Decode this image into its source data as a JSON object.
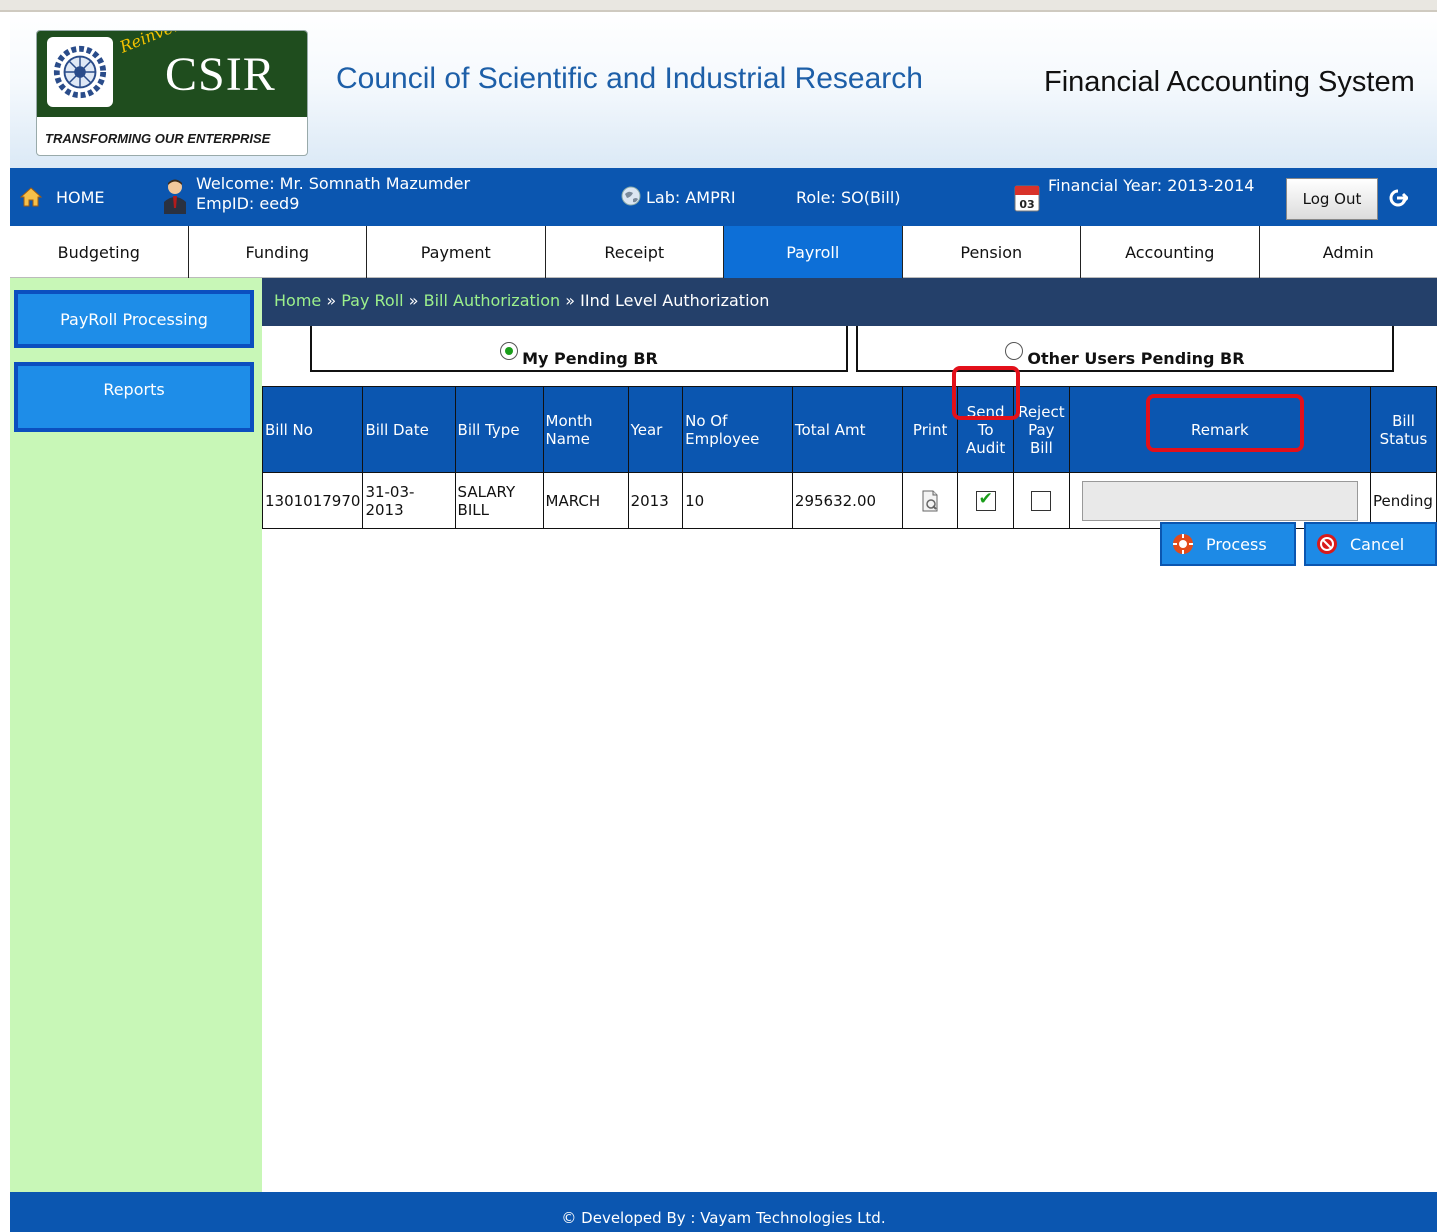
{
  "header": {
    "logo_text": "CSIR",
    "logo_script": "Reinventing",
    "logo_tagline": "TRANSFORMING OUR ENTERPRISE",
    "org_title": "Council of Scientific and Industrial Research",
    "system_title": "Financial Accounting System"
  },
  "userbar": {
    "home": "HOME",
    "welcome_line1": "Welcome: Mr. Somnath Mazumder",
    "welcome_line2": "EmpID: eed9",
    "lab": "Lab: AMPRI",
    "role": "Role: SO(Bill)",
    "financial_year": "Financial Year: 2013-2014",
    "logout": "Log Out",
    "calendar_day": "03"
  },
  "nav": {
    "tabs": [
      "Budgeting",
      "Funding",
      "Payment",
      "Receipt",
      "Payroll",
      "Pension",
      "Accounting",
      "Admin"
    ],
    "active": "Payroll"
  },
  "sidebar": {
    "items": [
      "PayRoll Processing",
      "Reports"
    ]
  },
  "breadcrumb": {
    "home": "Home",
    "sep": "»",
    "payroll": "Pay Roll",
    "bill_auth": "Bill Authorization",
    "current": "IInd Level Authorization"
  },
  "filters": {
    "my_pending": "My Pending BR",
    "other_pending": "Other Users Pending BR",
    "selected": "My Pending BR"
  },
  "table": {
    "headers": {
      "bill_no": "Bill No",
      "bill_date": "Bill Date",
      "bill_type": "Bill Type",
      "month_name": "Month Name",
      "year": "Year",
      "no_of_employee": "No Of Employee",
      "total_amt": "Total Amt",
      "print": "Print",
      "send_to_audit": "Send To Audit",
      "reject_pay_bill": "Reject Pay Bill",
      "remark": "Remark",
      "bill_status": "Bill Status"
    },
    "rows": [
      {
        "bill_no": "1301017970",
        "bill_date": "31-03-2013",
        "bill_type": "SALARY BILL",
        "month_name": "MARCH",
        "year": "2013",
        "no_of_employee": "10",
        "total_amt": "295632.00",
        "send_to_audit": true,
        "reject_pay_bill": false,
        "remark": "",
        "bill_status": "Pending"
      }
    ]
  },
  "actions": {
    "process": "Process",
    "cancel": "Cancel"
  },
  "footer": {
    "text": "© Developed By : Vayam Technologies Ltd."
  },
  "colors": {
    "primary_blue": "#0b56b0",
    "active_tab": "#0d6fd7",
    "sidebar_green": "#c8f7b7",
    "breadcrumb_bg": "#24406a",
    "breadcrumb_link": "#9cf08c",
    "highlight_red": "#e3101a",
    "title_blue": "#1d5fa8"
  },
  "icons": [
    "home-icon",
    "user-icon",
    "globe-icon",
    "calendar-icon",
    "logout-arrow-icon",
    "print-icon",
    "process-icon",
    "cancel-icon",
    "csir-gear-icon"
  ]
}
